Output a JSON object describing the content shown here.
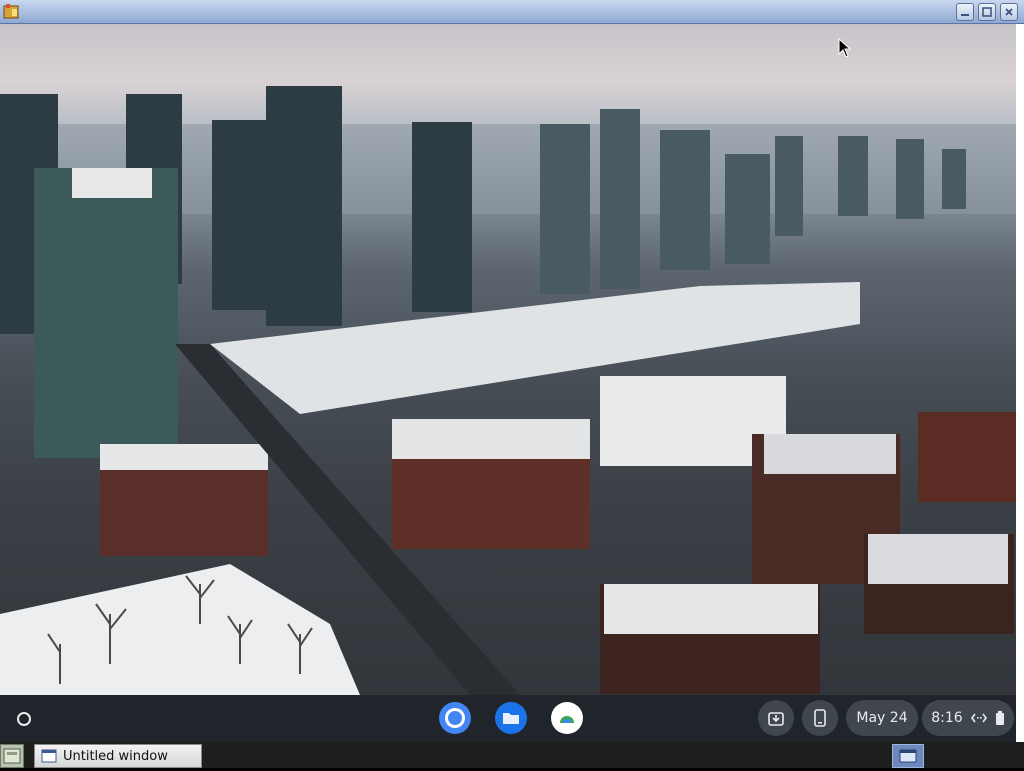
{
  "titlebar": {
    "buttons": [
      "minimize",
      "maximize",
      "close"
    ]
  },
  "desktop": {
    "wallpaper": "snowy city skyline aerial photo"
  },
  "shelf": {
    "launcher_icon": "launcher-circle-icon",
    "apps": [
      {
        "name": "Chrome",
        "icon": "chrome-icon",
        "color": "#4285f4"
      },
      {
        "name": "Files",
        "icon": "files-icon",
        "color": "#1a73e8"
      },
      {
        "name": "Play",
        "icon": "play-store-icon",
        "color": "#ffffff"
      }
    ],
    "tray": {
      "holding_space_icon": "holding-space-icon",
      "phone_hub_icon": "phone-icon",
      "date": "May 24",
      "time": "8:16",
      "network_icon": "ethernet-icon",
      "battery_icon": "battery-icon"
    }
  },
  "taskbar": {
    "task_label": "Untitled window"
  },
  "colors": {
    "titlebar": "#a9bde0",
    "shelf": "#20242a",
    "taskbar": "#1e1e1e",
    "tray_window": "#6c88bd"
  }
}
